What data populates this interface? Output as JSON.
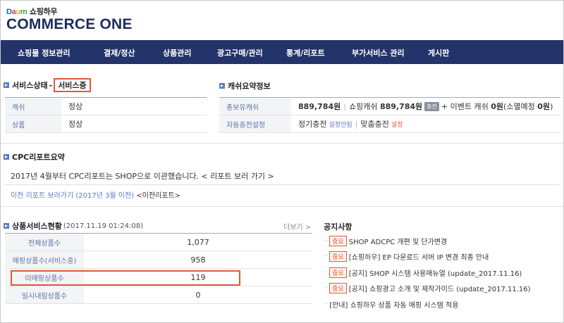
{
  "header": {
    "logo_daum": [
      "D",
      "a",
      "u",
      "m"
    ],
    "logo_sub": "쇼핑하우",
    "logo_main": "COMMERCE ONE"
  },
  "nav": [
    {
      "label": "쇼핑몰 정보관리"
    },
    {
      "label": "결제/정산"
    },
    {
      "label": "상품관리"
    },
    {
      "label": "광고구매/관리"
    },
    {
      "label": "통계/리포트"
    },
    {
      "label": "부가서비스 관리"
    },
    {
      "label": "게시판"
    }
  ],
  "service": {
    "title": "서비스상태",
    "dash": "-",
    "status": "서비스중",
    "rows": [
      {
        "label": "캐쉬",
        "value": "정상"
      },
      {
        "label": "상품",
        "value": "정상"
      }
    ]
  },
  "cash": {
    "title": "캐쉬요약정보",
    "row1_label": "총보유캐쉬",
    "row1_total": "889,784원",
    "row1_sep": "|",
    "row1_shop": "쇼핑캐쉬",
    "row1_shop_amount": "889,784원",
    "row1_tag": "충전",
    "row1_rest": "+ 이벤트 캐쉬",
    "row1_event": "0원",
    "row1_expire": "(소멸예정",
    "row1_expire_amount": "0원",
    "row1_close": ")",
    "row2_label": "자동충전설정",
    "row2_a": "정기충전",
    "row2_a_link": "설정안됨",
    "row2_sep": "|",
    "row2_b": "맞춤충전",
    "row2_b_link": "설정"
  },
  "cpc": {
    "title": "CPC리포트요약",
    "line": "2017년 4월부터 CPC리포트는 SHOP으로 이관했습니다. < 리포트 보러 가기 >",
    "prev_link": "이전 리포트 보러가기 (2017년 3월 이전)",
    "prev_link2": "<이전리포트>"
  },
  "stats": {
    "title": "상품서비스현황",
    "timestamp": "(2017.11.19 01:24:08)",
    "more": "더보기 >",
    "rows": [
      {
        "label": "전체상품수",
        "value": "1,077"
      },
      {
        "label": "매핑상품수(서비스중)",
        "value": "958"
      },
      {
        "label": "미매핑상품수",
        "value": "119"
      },
      {
        "label": "일시내림상품수",
        "value": "0"
      }
    ]
  },
  "notice": {
    "title": "공지사항",
    "items": [
      {
        "important": "중요",
        "text": "SHOP ADCPC 개편 및 단가변경"
      },
      {
        "important": "중요",
        "text": "[쇼핑하우] EP 다운로드 서버 IP 변경 최종 안내"
      },
      {
        "important": "중요",
        "text": "[공지] SHOP 시스템 사용매뉴얼 (update_2017.11.16)"
      },
      {
        "important": "중요",
        "text": "[공지] 쇼핑광고 소개 및 제작가이드 (update_2017.11.16)"
      },
      {
        "important": "",
        "text": "[안내] 쇼핑하우 상품 자동 매핑 시스템 적용"
      }
    ]
  },
  "colors": {
    "nav_bg": "#24336a",
    "accent_blue": "#5a7ac9",
    "highlight_red": "#e0593a"
  }
}
